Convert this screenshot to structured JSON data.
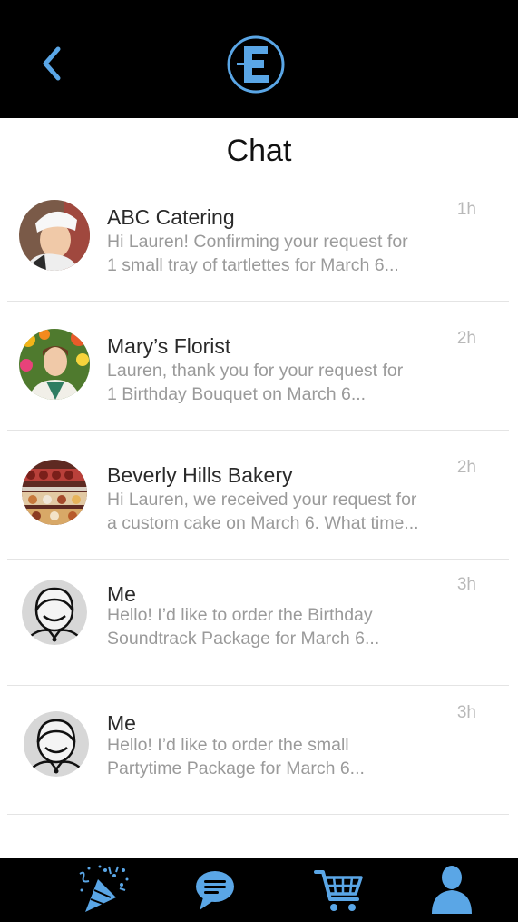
{
  "header": {
    "back_icon": "chevron-left-icon",
    "logo_icon": "e-logo-icon",
    "accent_color": "#5aa6e6"
  },
  "page": {
    "title": "Chat"
  },
  "conversations": [
    {
      "name": "ABC Catering",
      "line1": "Hi Lauren! Confirming your request for",
      "line2": "1 small tray of tartlettes for March 6...",
      "time": "1h",
      "avatar": "chef-photo"
    },
    {
      "name": "Mary’s Florist",
      "line1": "Lauren, thank you for your request for",
      "line2": "1 Birthday Bouquet on March 6...",
      "time": "2h",
      "avatar": "florist-photo"
    },
    {
      "name": "Beverly Hills Bakery",
      "line1": "Hi Lauren, we received your request for",
      "line2": "a custom cake on March 6. What time...",
      "time": "2h",
      "avatar": "bakery-photo"
    },
    {
      "name": "Me",
      "line1": "Hello! I’d like to order the Birthday",
      "line2": "Soundtrack Package for March 6...",
      "time": "3h",
      "avatar": "user-avatar-icon"
    },
    {
      "name": "Me",
      "line1": "Hello! I’d like to order the small",
      "line2": "Partytime Package for March 6...",
      "time": "3h",
      "avatar": "user-avatar-icon"
    }
  ],
  "tabbar": {
    "items": [
      "party-popper-icon",
      "chat-bubble-icon",
      "cart-icon",
      "profile-icon"
    ],
    "active": "chat-bubble-icon"
  }
}
